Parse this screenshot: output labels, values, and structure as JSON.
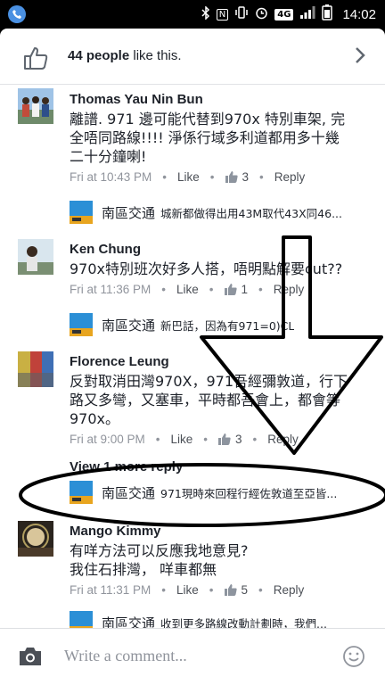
{
  "status_bar": {
    "time": "14:02",
    "network": "4G"
  },
  "likes": {
    "count_text": "44 people",
    "suffix": " like this."
  },
  "comments": [
    {
      "name": "Thomas Yau Nin Bun",
      "lines": [
        "離譜. 971 邊可能代替到970x 特別車架, 完",
        "全唔同路線!!!! 淨係行域多利道都用多十幾",
        "二十分鐘喇!"
      ],
      "time": "Fri at 10:43 PM",
      "like": "Like",
      "reactions": "3",
      "reply": "Reply",
      "reply_name": "南區交通",
      "reply_text": "城新都做得出用43M取代43X同46..."
    },
    {
      "name": "Ken Chung",
      "lines": [
        "970x特別班次好多人搭，唔明點解要cut??"
      ],
      "time": "Fri at 11:36 PM",
      "like": "Like",
      "reactions": "1",
      "reply": "Reply",
      "reply_name": "南區交通",
      "reply_text": "新巴話，因為有971=0)CL"
    },
    {
      "name": "Florence Leung",
      "lines": [
        "反對取消田灣970X，971吾經彌敦道，行下",
        "路又多彎，又塞車，平時都吾會上，都會等",
        "970x。"
      ],
      "time": "Fri at 9:00 PM",
      "like": "Like",
      "reactions": "3",
      "reply": "Reply",
      "view_more": "View 1 more reply",
      "reply_name": "南區交通",
      "reply_text": "971現時來回程行經佐敦道至亞皆..."
    },
    {
      "name": "Mango Kimmy",
      "lines": [
        "有咩方法可以反應我地意見?",
        "我住石排灣， 咩車都無"
      ],
      "time": "Fri at 11:31 PM",
      "like": "Like",
      "reactions": "5",
      "reply": "Reply",
      "reply_name": "南區交通",
      "reply_text": "收到更多路線改動計劃時，我們..."
    }
  ],
  "page_logo_text": [
    "南區",
    "交通"
  ],
  "composer": {
    "placeholder": "Write a comment..."
  },
  "colors": {
    "accent": "#4267b2",
    "meta": "#90949c",
    "text": "#1d2129"
  }
}
